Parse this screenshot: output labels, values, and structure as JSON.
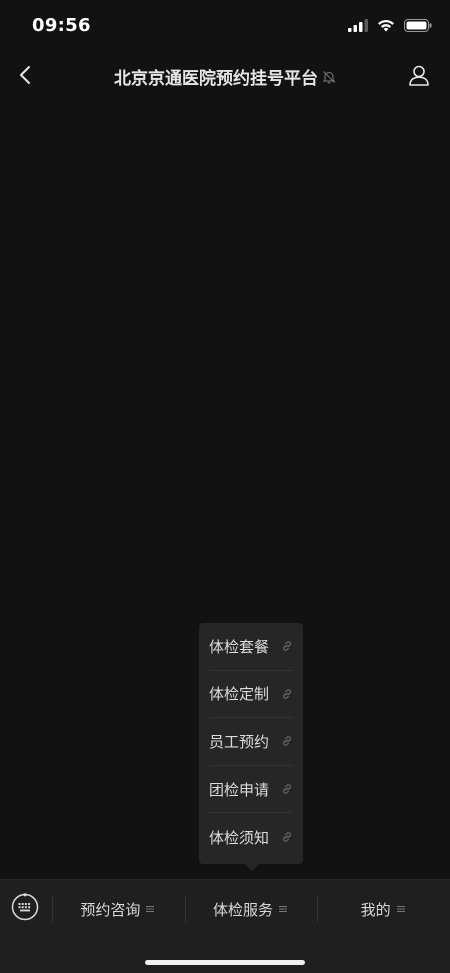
{
  "status_bar": {
    "time": "09:56",
    "icons": [
      "cellular-signal-icon",
      "wifi-icon",
      "battery-icon"
    ]
  },
  "nav": {
    "title": "北京京通医院预约挂号平台",
    "back_icon": "chevron-left-icon",
    "mute_icon": "bell-muted-icon",
    "profile_icon": "person-icon"
  },
  "popup_menu": {
    "items": [
      {
        "label": "体检套餐",
        "icon": "link-icon"
      },
      {
        "label": "体检定制",
        "icon": "link-icon"
      },
      {
        "label": "员工预约",
        "icon": "link-icon"
      },
      {
        "label": "团检申请",
        "icon": "link-icon"
      },
      {
        "label": "体检须知",
        "icon": "link-icon"
      }
    ]
  },
  "bottom_menu": {
    "keyboard_icon": "keyboard-icon",
    "items": [
      {
        "label": "预约咨询",
        "icon": "menu-lines-icon"
      },
      {
        "label": "体检服务",
        "icon": "menu-lines-icon"
      },
      {
        "label": "我的",
        "icon": "menu-lines-icon"
      }
    ]
  },
  "colors": {
    "background": "#121212",
    "popup_background": "#262626",
    "bottom_bar_background": "#1f1f1f",
    "text": "#e6e6e6"
  }
}
